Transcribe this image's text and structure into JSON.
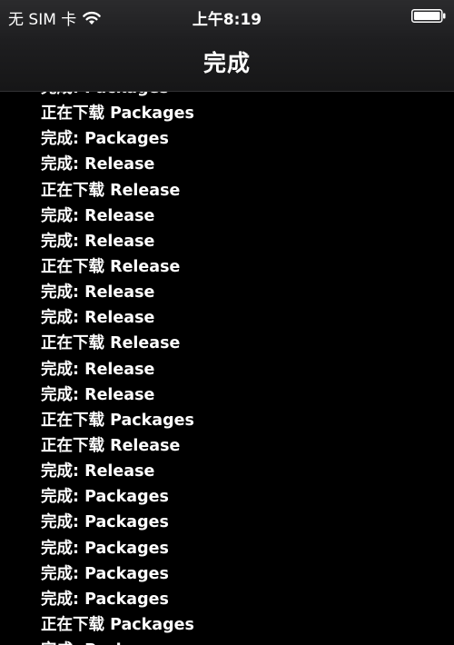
{
  "status_bar": {
    "carrier": "无 SIM 卡",
    "time": "上午8:19",
    "icons": [
      "wifi-icon",
      "battery-icon"
    ]
  },
  "nav": {
    "title": "完成"
  },
  "log": {
    "lines": [
      "完成: Packages",
      "正在下载 Packages",
      "完成: Packages",
      "完成: Release",
      "正在下载 Release",
      "完成: Release",
      "完成: Release",
      "正在下载 Release",
      "完成: Release",
      "完成: Release",
      "正在下载 Release",
      "完成: Release",
      "完成: Release",
      "正在下载 Packages",
      "正在下载 Release",
      "完成: Release",
      "完成: Packages",
      "完成: Packages",
      "完成: Packages",
      "完成: Packages",
      "完成: Packages",
      "正在下载 Packages",
      "完成: Packages"
    ]
  },
  "colors": {
    "background": "#000000",
    "text": "#ffffff",
    "header": "#1e1e20"
  }
}
